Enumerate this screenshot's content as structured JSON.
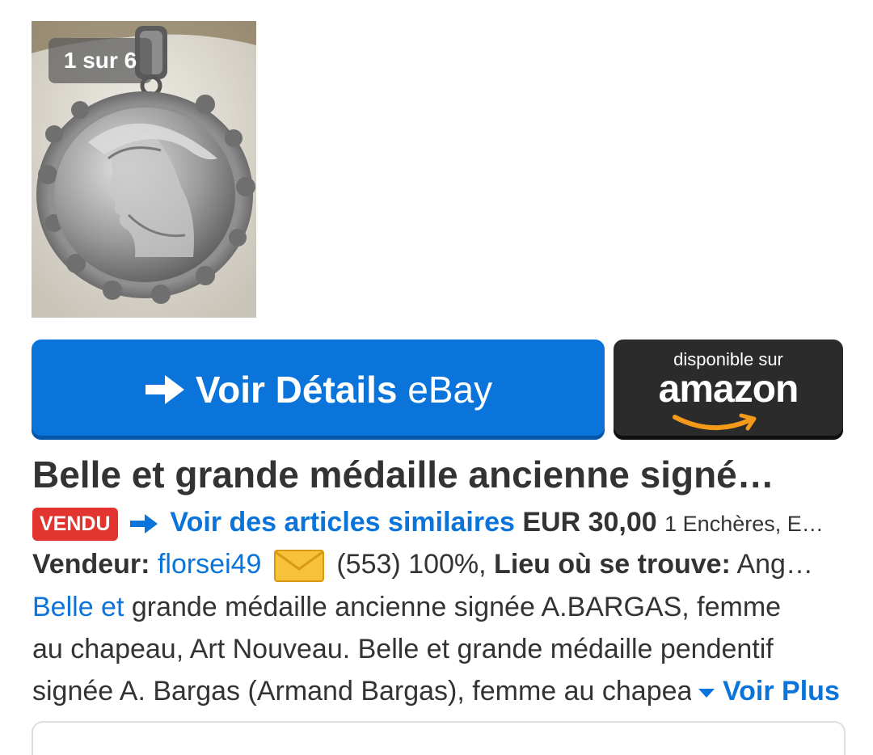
{
  "gallery": {
    "counter": "1 sur 6",
    "image_icon": "pendant-photo"
  },
  "buttons": {
    "ebay_bold": "Voir Détails",
    "ebay_rest": "eBay",
    "amazon_small": "disponible sur",
    "amazon_brand": "amazon"
  },
  "item": {
    "title": "Belle et grande médaille ancienne signé…",
    "status_badge": "VENDU",
    "similar_link": "Voir des articles similaires",
    "price": "EUR 30,00",
    "bids": "1 Enchères, E…",
    "seller_label": "Vendeur:",
    "seller_name": "florsei49",
    "feedback": "(553) 100%,",
    "location_label": "Lieu où se trouve:",
    "location_value": "Ang…",
    "desc_link": "Belle et",
    "desc_line1_rest": " grande médaille ancienne signée A.BARGAS, femme",
    "desc_line2": "au chapeau, Art Nouveau. Belle et grande médaille pendentif",
    "desc_line3": "signée A. Bargas (Armand Bargas), femme au chapeau",
    "more_label": "Voir Plus"
  },
  "colors": {
    "ebay_blue": "#0a74da",
    "amazon_dark": "#2b2b2b",
    "amazon_orange": "#f49a1a",
    "badge_red": "#e2352f",
    "envelope_yellow": "#f7c23a"
  }
}
